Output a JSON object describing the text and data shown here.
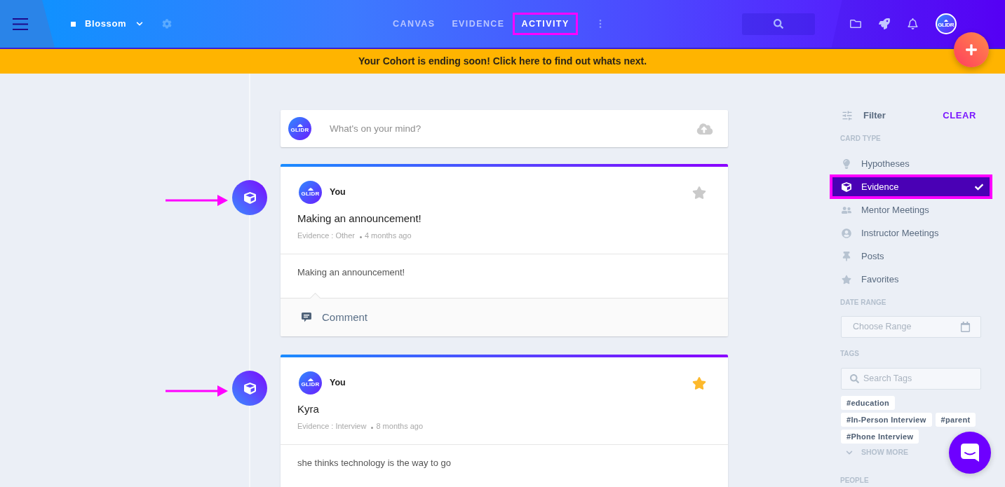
{
  "header": {
    "project": "Blossom",
    "tabs": [
      {
        "label": "CANVAS",
        "selected": false,
        "highlighted": false
      },
      {
        "label": "EVIDENCE",
        "selected": false,
        "highlighted": false
      },
      {
        "label": "ACTIVITY",
        "selected": true,
        "highlighted": true
      }
    ],
    "avatar": "GLIDR"
  },
  "banner": "Your Cohort is ending soon! Click here to find out whats next.",
  "composer": {
    "avatar": "GLIDR",
    "placeholder": "What's on your mind?"
  },
  "posts": [
    {
      "kind": "evidence",
      "highlighted": true,
      "avatar": "GLIDR",
      "author": "You",
      "favorite": false,
      "title": "Making an announcement!",
      "category": "Evidence : Other",
      "time": "4 months ago",
      "body": "Making an announcement!",
      "comment": "Comment"
    },
    {
      "kind": "evidence",
      "highlighted": true,
      "avatar": "GLIDR",
      "author": "You",
      "favorite": true,
      "title": "Kyra",
      "category": "Evidence : Interview",
      "time": "8 months ago",
      "body": "she thinks technology is the way to go"
    }
  ],
  "filter": {
    "title": "Filter",
    "clear": "CLEAR",
    "card_type": {
      "label": "CARD TYPE",
      "items": [
        {
          "kind": "bulb",
          "label": "Hypotheses",
          "selected": false,
          "highlighted": false
        },
        {
          "kind": "cube",
          "label": "Evidence",
          "selected": true,
          "highlighted": true
        },
        {
          "kind": "people",
          "label": "Mentor Meetings",
          "selected": false,
          "highlighted": false
        },
        {
          "kind": "person",
          "label": "Instructor Meetings",
          "selected": false,
          "highlighted": false
        },
        {
          "kind": "pin",
          "label": "Posts",
          "selected": false,
          "highlighted": false
        },
        {
          "kind": "star",
          "label": "Favorites",
          "selected": false,
          "highlighted": false
        }
      ]
    },
    "date_range": {
      "label": "DATE RANGE",
      "placeholder": "Choose Range"
    },
    "tags": {
      "label": "TAGS",
      "placeholder": "Search Tags",
      "items": [
        "#education",
        "#In-Person Interview",
        "#parent",
        "#Phone Interview"
      ],
      "show_more": "SHOW MORE"
    },
    "people": {
      "label": "PEOPLE"
    }
  }
}
